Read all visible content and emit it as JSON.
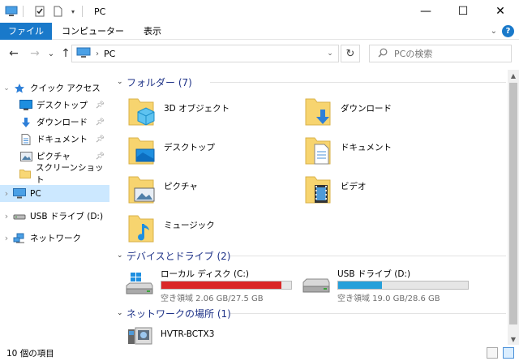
{
  "window": {
    "title": "PC",
    "minimize": "—",
    "maximize": "☐",
    "close": "✕"
  },
  "ribbon": {
    "tabs": [
      "ファイル",
      "コンピューター",
      "表示"
    ],
    "help": "?"
  },
  "nav": {
    "back": "←",
    "forward": "→",
    "recent": "⌄",
    "up": "↑",
    "address_arrow": "›",
    "address": "PC",
    "refresh": "↻",
    "search_placeholder": "PCの検索"
  },
  "sidebar": {
    "quick_access": "クイック アクセス",
    "items": [
      {
        "label": "デスクトップ",
        "icon": "desktop-icon",
        "pinned": true
      },
      {
        "label": "ダウンロード",
        "icon": "download-icon",
        "pinned": true
      },
      {
        "label": "ドキュメント",
        "icon": "documents-icon",
        "pinned": true
      },
      {
        "label": "ピクチャ",
        "icon": "pictures-icon",
        "pinned": true
      },
      {
        "label": "スクリーンショット",
        "icon": "folder-icon",
        "pinned": false
      }
    ],
    "pc": "PC",
    "usb": "USB ドライブ (D:)",
    "network": "ネットワーク"
  },
  "content": {
    "folders_header": "フォルダー (7)",
    "folders": [
      {
        "name": "3D オブジェクト",
        "icon": "3d-objects-icon"
      },
      {
        "name": "ダウンロード",
        "icon": "download-folder-icon"
      },
      {
        "name": "デスクトップ",
        "icon": "desktop-folder-icon"
      },
      {
        "name": "ドキュメント",
        "icon": "documents-folder-icon"
      },
      {
        "name": "ピクチャ",
        "icon": "pictures-folder-icon"
      },
      {
        "name": "ビデオ",
        "icon": "videos-folder-icon"
      },
      {
        "name": "ミュージック",
        "icon": "music-folder-icon"
      }
    ],
    "drives_header": "デバイスとドライブ (2)",
    "drives": [
      {
        "name": "ローカル ディスク (C:)",
        "free": "空き領域 2.06 GB/27.5 GB",
        "used_fraction": 0.925,
        "bar_color": "#da2626",
        "icon": "windows-drive-icon"
      },
      {
        "name": "USB ドライブ (D:)",
        "free": "空き領域 19.0 GB/28.6 GB",
        "used_fraction": 0.336,
        "bar_color": "#26a0da",
        "icon": "usb-drive-icon"
      }
    ],
    "network_header": "ネットワークの場所 (1)",
    "network_items": [
      {
        "name": "HVTR-BCTX3",
        "icon": "media-device-icon"
      }
    ]
  },
  "status": {
    "count": "10 個の項目"
  },
  "colors": {
    "accent": "#1979ca",
    "selection": "#cce8ff",
    "group_header": "#1e3287"
  }
}
